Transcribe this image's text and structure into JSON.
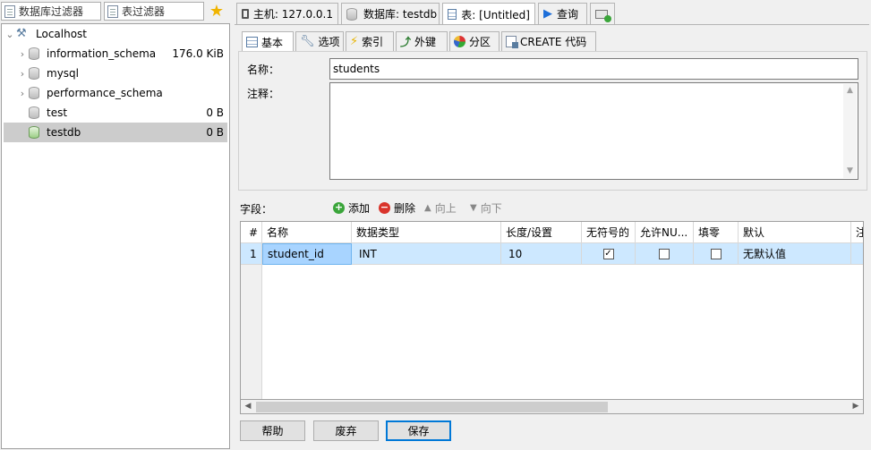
{
  "left": {
    "db_filter_placeholder": "数据库过滤器",
    "table_filter_placeholder": "表过滤器",
    "tree": {
      "root": "Localhost",
      "items": [
        {
          "name": "information_schema",
          "size": "176.0 KiB",
          "expandable": true
        },
        {
          "name": "mysql",
          "size": "",
          "expandable": true
        },
        {
          "name": "performance_schema",
          "size": "",
          "expandable": true
        },
        {
          "name": "test",
          "size": "0 B",
          "expandable": false
        },
        {
          "name": "testdb",
          "size": "0 B",
          "expandable": false,
          "selected": true
        }
      ]
    }
  },
  "top_tabs": [
    {
      "label": "主机: 127.0.0.1",
      "icon": "monitor-icon"
    },
    {
      "label": "数据库: testdb",
      "icon": "database-icon"
    },
    {
      "label": "表: [Untitled]",
      "icon": "table-icon",
      "active": true
    },
    {
      "label": "查询",
      "icon": "play-icon"
    },
    {
      "label": "",
      "icon": "new-query-icon"
    }
  ],
  "sub_tabs": [
    {
      "label": "基本",
      "icon": "table-icon",
      "active": true
    },
    {
      "label": "选项",
      "icon": "wrench-icon"
    },
    {
      "label": "索引",
      "icon": "lightning-icon"
    },
    {
      "label": "外键",
      "icon": "foreign-key-icon"
    },
    {
      "label": "分区",
      "icon": "pie-icon"
    },
    {
      "label": "CREATE 代码",
      "icon": "code-icon"
    }
  ],
  "basic": {
    "name_label": "名称：",
    "name_value": "students",
    "comment_label": "注释：",
    "comment_value": ""
  },
  "fields": {
    "label": "字段：",
    "add": "添加",
    "delete": "删除",
    "up": "向上",
    "down": "向下",
    "columns": [
      "#",
      "名称",
      "数据类型",
      "长度/设置",
      "无符号的",
      "允许NU...",
      "填零",
      "默认",
      "注"
    ],
    "rows": [
      {
        "num": "1",
        "name": "student_id",
        "type": "INT",
        "length": "10",
        "unsigned": true,
        "allow_null": false,
        "zerofill": false,
        "default": "无默认值"
      }
    ]
  },
  "buttons": {
    "help": "帮助",
    "discard": "废弃",
    "save": "保存"
  },
  "colors": {
    "selection": "#cde8ff",
    "tree_selection": "#cccccc",
    "accent": "#0078d7"
  }
}
